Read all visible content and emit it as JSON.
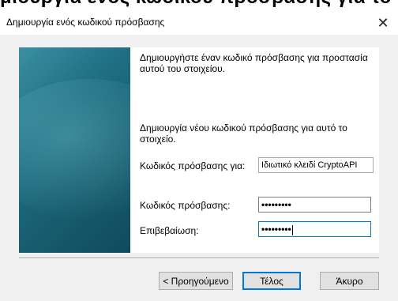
{
  "window": {
    "header_cut_text": "μιουργία ενός κωδικού πρόσβασης για το στοιχείο",
    "title": "Δημιουργία ενός κωδικού πρόσβασης",
    "close_glyph": "✕"
  },
  "content": {
    "intro": "Δημιουργήστε έναν κωδικό πρόσβασης για προστασία αυτού του στοιχείου.",
    "create_text": "Δημιουργία νέου κωδικού πρόσβασης για αυτό το στοιχείο.",
    "password_for_label": "Κωδικός πρόσβασης για:",
    "password_for_value": "Ιδιωτικό κλειδί CryptoAPI",
    "password_label": "Κωδικός πρόσβασης:",
    "password_value": "•••••••••",
    "confirm_label": "Επιβεβαίωση:",
    "confirm_value": "•••••••••"
  },
  "buttons": {
    "back": "< Προηγούμενο",
    "finish": "Τέλος",
    "cancel": "Άκυρο"
  },
  "colors": {
    "accent": "#0078d7",
    "panel_dark": "#0f4b5c",
    "panel_light": "#3a8fa0"
  }
}
